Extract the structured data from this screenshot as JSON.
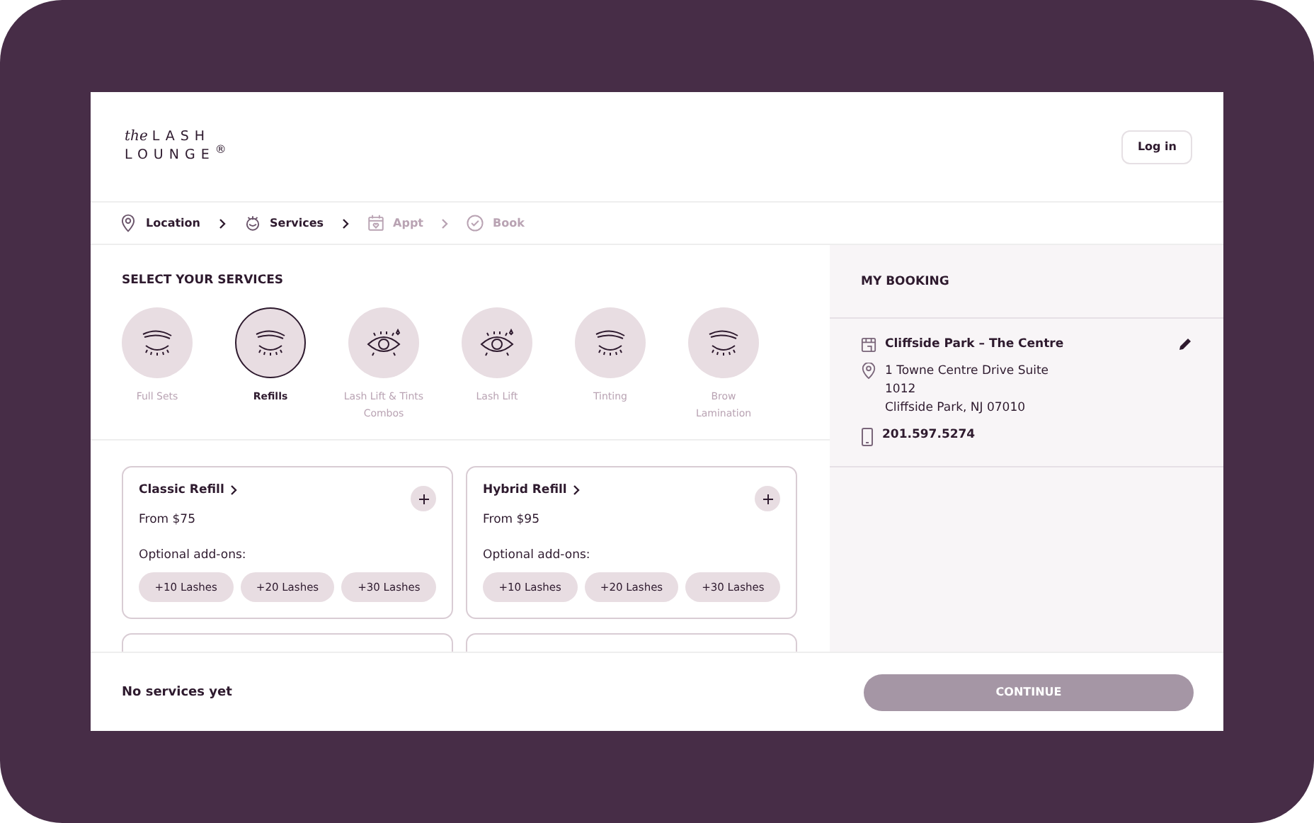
{
  "logo": {
    "script": "the",
    "line_1": "LASH",
    "line_2": "LOUNGE$^{®}$"
  },
  "login_button": "Log in",
  "steps": [
    {
      "label": "Location",
      "kind": "pin",
      "active": true
    },
    {
      "label": "Services",
      "kind": "lashes",
      "active": true
    },
    {
      "label": "Appt",
      "kind": "calendar",
      "active": false
    },
    {
      "label": "Book",
      "kind": "check",
      "active": false
    }
  ],
  "section_title": "SELECT YOUR SERVICES",
  "categories": [
    {
      "label": "Full Sets",
      "kind": "closed",
      "selected": false
    },
    {
      "label": "Refills",
      "kind": "closed",
      "selected": true
    },
    {
      "label": "Lash Lift & Tints Combos",
      "kind": "open",
      "selected": false
    },
    {
      "label": "Lash Lift",
      "kind": "open",
      "selected": false
    },
    {
      "label": "Tinting",
      "kind": "closed",
      "selected": false
    },
    {
      "label": "Brow Lamination",
      "kind": "closed",
      "selected": false
    }
  ],
  "services": [
    {
      "kind": "full",
      "name": "Classic Refill",
      "price": "From $75",
      "addons_label": "Optional add-ons:",
      "addons": [
        "+10 Lashes",
        "+20 Lashes",
        "+30 Lashes"
      ]
    },
    {
      "kind": "full",
      "name": "Hybrid Refill",
      "price": "From $95",
      "addons_label": "Optional add-ons:",
      "addons": [
        "+10 Lashes",
        "+20 Lashes",
        "+30 Lashes"
      ]
    },
    {
      "kind": "partial"
    },
    {
      "kind": "partial"
    }
  ],
  "footer": {
    "summary": "No services yet",
    "continue_button": "CONTINUE",
    "continue_disabled": true
  },
  "booking": {
    "title": "MY BOOKING",
    "store_name": "Cliffside Park – The Centre",
    "address_lines": [
      "1 Towne Centre Drive Suite",
      "1012",
      "Cliffside Park, NJ 07010"
    ],
    "phone": "201.597.5274"
  }
}
